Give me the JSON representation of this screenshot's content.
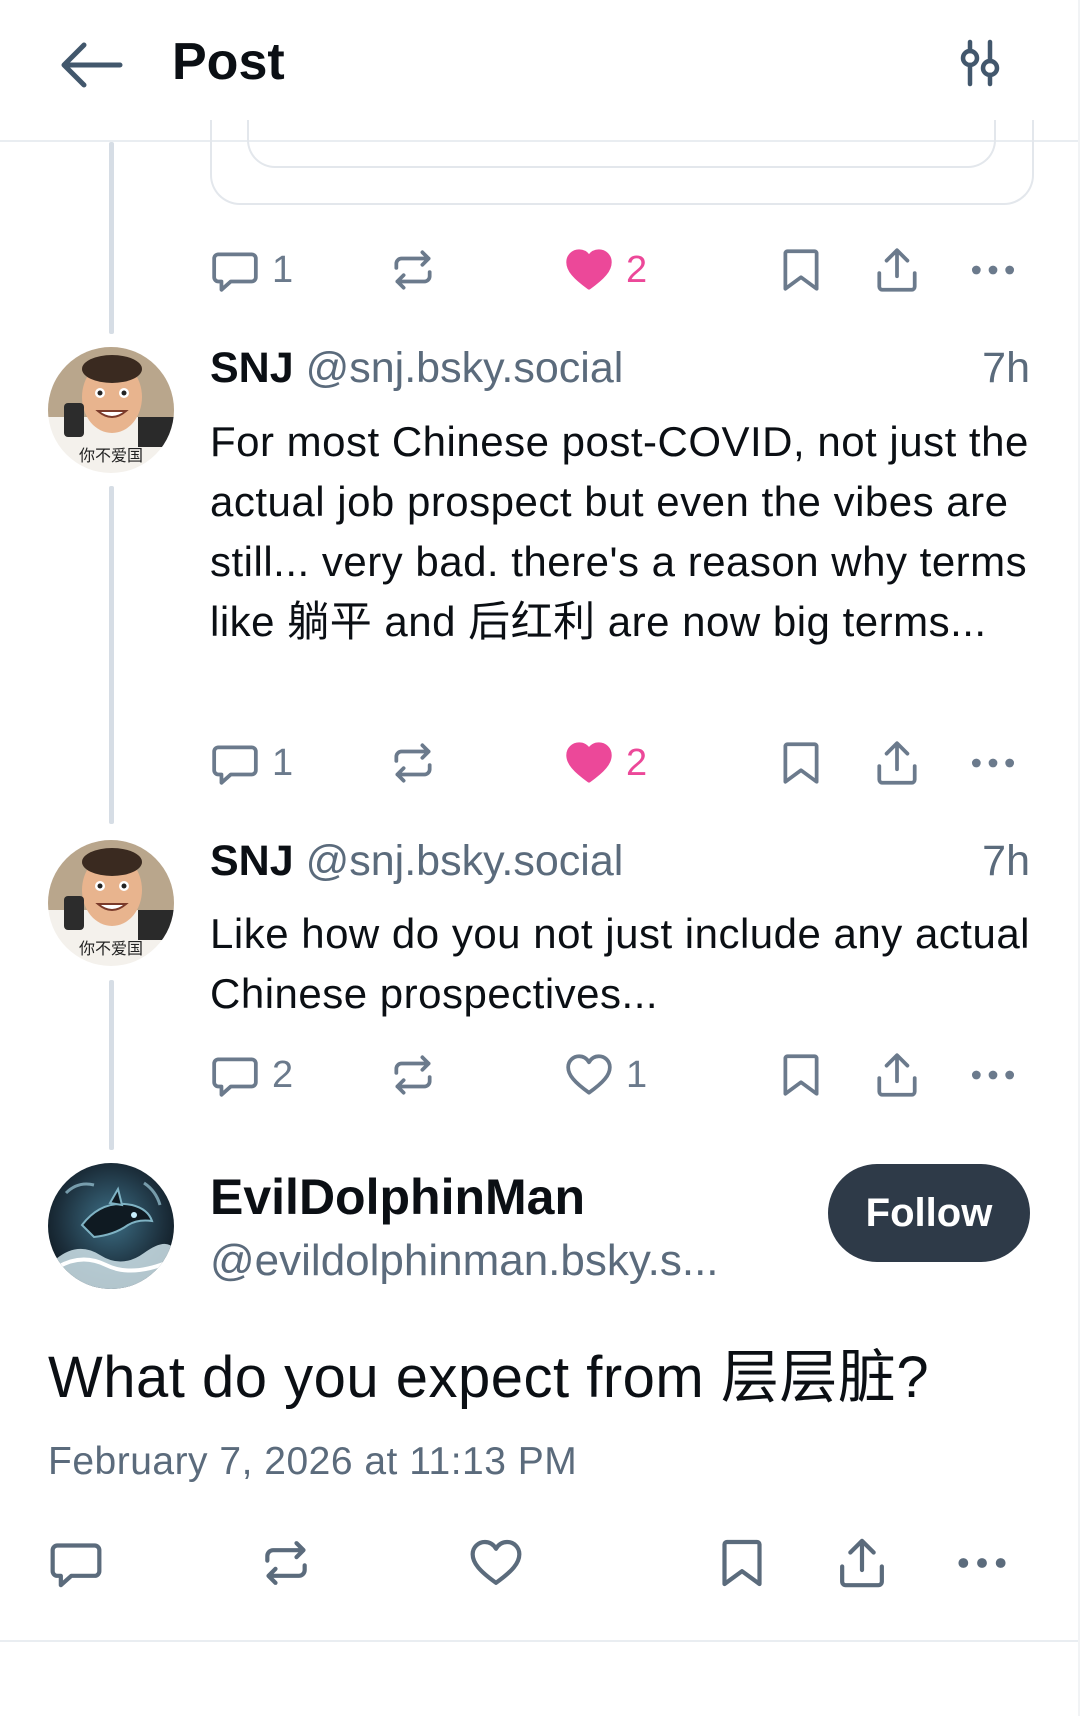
{
  "header": {
    "title": "Post"
  },
  "colors": {
    "like": "#ec4899",
    "muted": "#6b7a8c",
    "follow_bg": "#2e3a48",
    "thread_line": "#d6dde5"
  },
  "parent_actions": {
    "replies": "1",
    "likes": "2",
    "liked": true
  },
  "replies": [
    {
      "name": "SNJ",
      "handle": "@snj.bsky.social",
      "time": "7h",
      "avatar_caption": "你不爱国",
      "text": "For most Chinese post-COVID, not just the actual job prospect but even the vibes are still... very bad. there's a reason why terms like 躺平 and 后红利 are now big terms...",
      "replies": "1",
      "likes": "2",
      "liked": true
    },
    {
      "name": "SNJ",
      "handle": "@snj.bsky.social",
      "time": "7h",
      "avatar_caption": "你不爱国",
      "text": "Like how do you not just include any actual Chinese prospectives...",
      "replies": "2",
      "likes": "1",
      "liked": false
    }
  ],
  "main_post": {
    "name": "EvilDolphinMan",
    "handle": "@evildolphinman.bsky.s...",
    "follow_label": "Follow",
    "text": "What do you expect from 层层脏?",
    "date": "February 7, 2026 at 11:13 PM"
  },
  "icons": [
    "back-arrow-icon",
    "filter-sliders-icon",
    "reply-icon",
    "repost-icon",
    "heart-icon",
    "bookmark-icon",
    "share-icon",
    "more-icon"
  ]
}
